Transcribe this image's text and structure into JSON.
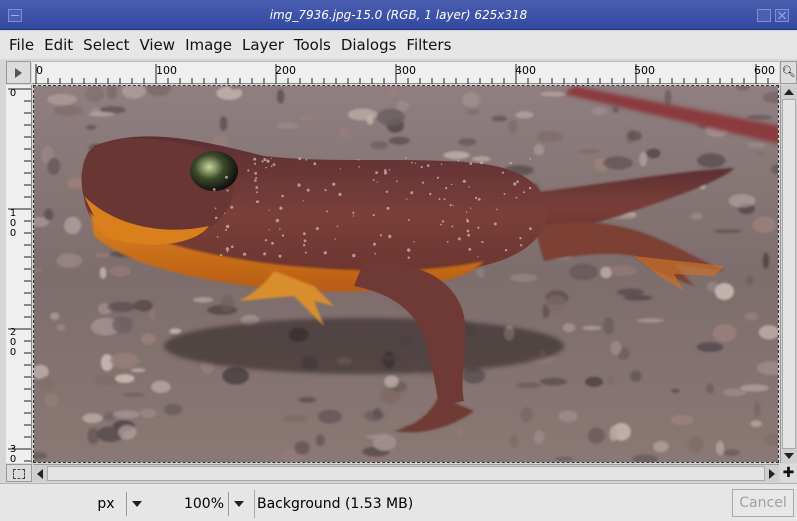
{
  "window": {
    "title": "img_7936.jpg-15.0 (RGB, 1 layer) 625x318"
  },
  "menubar": {
    "items": [
      "File",
      "Edit",
      "Select",
      "View",
      "Image",
      "Layer",
      "Tools",
      "Dialogs",
      "Filters"
    ]
  },
  "rulers": {
    "horizontal_labels": [
      "0",
      "100",
      "200",
      "300",
      "400",
      "500",
      "600"
    ],
    "vertical_labels": [
      "0",
      "1\n0\n0",
      "2\n0\n0",
      "3\n0"
    ]
  },
  "canvas": {
    "image_subject": "salamander on gravel",
    "image_icon": "photo-canvas"
  },
  "statusbar": {
    "unit": "px",
    "zoom": "100%",
    "message": "Background (1.53 MB)",
    "cancel_label": "Cancel"
  },
  "colors": {
    "titlebar": "#3c50a8",
    "salamander_body": "#6b3a36",
    "salamander_belly": "#d97a1c",
    "gravel": "#8a7a78"
  }
}
